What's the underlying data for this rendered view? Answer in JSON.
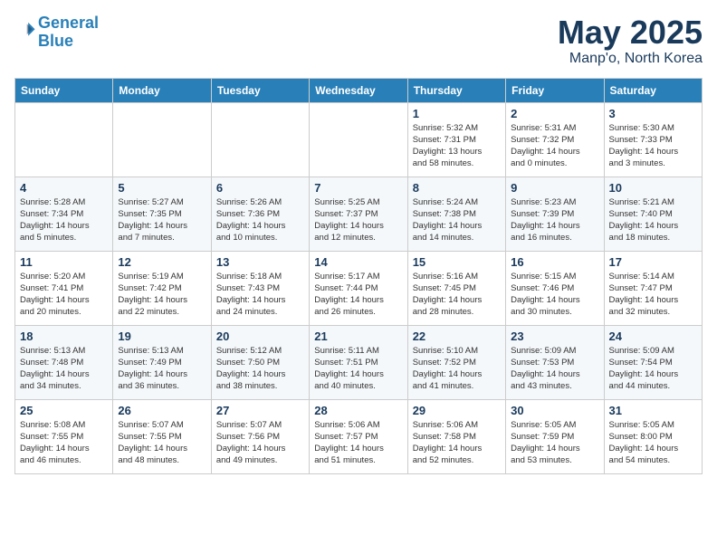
{
  "header": {
    "logo_line1": "General",
    "logo_line2": "Blue",
    "month_title": "May 2025",
    "location": "Manp'o, North Korea"
  },
  "weekdays": [
    "Sunday",
    "Monday",
    "Tuesday",
    "Wednesday",
    "Thursday",
    "Friday",
    "Saturday"
  ],
  "weeks": [
    [
      {
        "day": "",
        "info": ""
      },
      {
        "day": "",
        "info": ""
      },
      {
        "day": "",
        "info": ""
      },
      {
        "day": "",
        "info": ""
      },
      {
        "day": "1",
        "info": "Sunrise: 5:32 AM\nSunset: 7:31 PM\nDaylight: 13 hours\nand 58 minutes."
      },
      {
        "day": "2",
        "info": "Sunrise: 5:31 AM\nSunset: 7:32 PM\nDaylight: 14 hours\nand 0 minutes."
      },
      {
        "day": "3",
        "info": "Sunrise: 5:30 AM\nSunset: 7:33 PM\nDaylight: 14 hours\nand 3 minutes."
      }
    ],
    [
      {
        "day": "4",
        "info": "Sunrise: 5:28 AM\nSunset: 7:34 PM\nDaylight: 14 hours\nand 5 minutes."
      },
      {
        "day": "5",
        "info": "Sunrise: 5:27 AM\nSunset: 7:35 PM\nDaylight: 14 hours\nand 7 minutes."
      },
      {
        "day": "6",
        "info": "Sunrise: 5:26 AM\nSunset: 7:36 PM\nDaylight: 14 hours\nand 10 minutes."
      },
      {
        "day": "7",
        "info": "Sunrise: 5:25 AM\nSunset: 7:37 PM\nDaylight: 14 hours\nand 12 minutes."
      },
      {
        "day": "8",
        "info": "Sunrise: 5:24 AM\nSunset: 7:38 PM\nDaylight: 14 hours\nand 14 minutes."
      },
      {
        "day": "9",
        "info": "Sunrise: 5:23 AM\nSunset: 7:39 PM\nDaylight: 14 hours\nand 16 minutes."
      },
      {
        "day": "10",
        "info": "Sunrise: 5:21 AM\nSunset: 7:40 PM\nDaylight: 14 hours\nand 18 minutes."
      }
    ],
    [
      {
        "day": "11",
        "info": "Sunrise: 5:20 AM\nSunset: 7:41 PM\nDaylight: 14 hours\nand 20 minutes."
      },
      {
        "day": "12",
        "info": "Sunrise: 5:19 AM\nSunset: 7:42 PM\nDaylight: 14 hours\nand 22 minutes."
      },
      {
        "day": "13",
        "info": "Sunrise: 5:18 AM\nSunset: 7:43 PM\nDaylight: 14 hours\nand 24 minutes."
      },
      {
        "day": "14",
        "info": "Sunrise: 5:17 AM\nSunset: 7:44 PM\nDaylight: 14 hours\nand 26 minutes."
      },
      {
        "day": "15",
        "info": "Sunrise: 5:16 AM\nSunset: 7:45 PM\nDaylight: 14 hours\nand 28 minutes."
      },
      {
        "day": "16",
        "info": "Sunrise: 5:15 AM\nSunset: 7:46 PM\nDaylight: 14 hours\nand 30 minutes."
      },
      {
        "day": "17",
        "info": "Sunrise: 5:14 AM\nSunset: 7:47 PM\nDaylight: 14 hours\nand 32 minutes."
      }
    ],
    [
      {
        "day": "18",
        "info": "Sunrise: 5:13 AM\nSunset: 7:48 PM\nDaylight: 14 hours\nand 34 minutes."
      },
      {
        "day": "19",
        "info": "Sunrise: 5:13 AM\nSunset: 7:49 PM\nDaylight: 14 hours\nand 36 minutes."
      },
      {
        "day": "20",
        "info": "Sunrise: 5:12 AM\nSunset: 7:50 PM\nDaylight: 14 hours\nand 38 minutes."
      },
      {
        "day": "21",
        "info": "Sunrise: 5:11 AM\nSunset: 7:51 PM\nDaylight: 14 hours\nand 40 minutes."
      },
      {
        "day": "22",
        "info": "Sunrise: 5:10 AM\nSunset: 7:52 PM\nDaylight: 14 hours\nand 41 minutes."
      },
      {
        "day": "23",
        "info": "Sunrise: 5:09 AM\nSunset: 7:53 PM\nDaylight: 14 hours\nand 43 minutes."
      },
      {
        "day": "24",
        "info": "Sunrise: 5:09 AM\nSunset: 7:54 PM\nDaylight: 14 hours\nand 44 minutes."
      }
    ],
    [
      {
        "day": "25",
        "info": "Sunrise: 5:08 AM\nSunset: 7:55 PM\nDaylight: 14 hours\nand 46 minutes."
      },
      {
        "day": "26",
        "info": "Sunrise: 5:07 AM\nSunset: 7:55 PM\nDaylight: 14 hours\nand 48 minutes."
      },
      {
        "day": "27",
        "info": "Sunrise: 5:07 AM\nSunset: 7:56 PM\nDaylight: 14 hours\nand 49 minutes."
      },
      {
        "day": "28",
        "info": "Sunrise: 5:06 AM\nSunset: 7:57 PM\nDaylight: 14 hours\nand 51 minutes."
      },
      {
        "day": "29",
        "info": "Sunrise: 5:06 AM\nSunset: 7:58 PM\nDaylight: 14 hours\nand 52 minutes."
      },
      {
        "day": "30",
        "info": "Sunrise: 5:05 AM\nSunset: 7:59 PM\nDaylight: 14 hours\nand 53 minutes."
      },
      {
        "day": "31",
        "info": "Sunrise: 5:05 AM\nSunset: 8:00 PM\nDaylight: 14 hours\nand 54 minutes."
      }
    ]
  ]
}
